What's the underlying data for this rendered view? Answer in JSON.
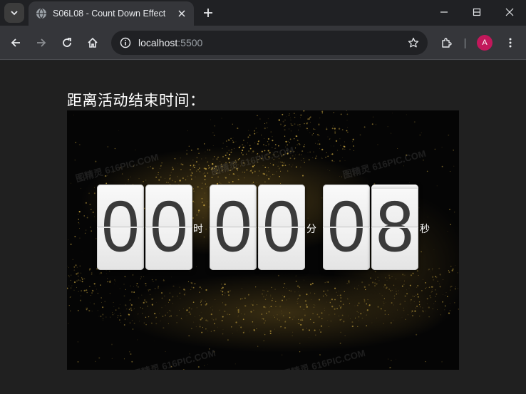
{
  "browser": {
    "tab_title": "S06L08 - Count Down Effect",
    "url_host": "localhost",
    "url_port": ":5500",
    "profile_initial": "A"
  },
  "page": {
    "heading": "距离活动结束时间：",
    "countdown": {
      "hours": [
        "0",
        "0"
      ],
      "minutes": [
        "0",
        "0"
      ],
      "seconds": [
        "0",
        "8"
      ],
      "unit_hours": "时",
      "unit_minutes": "分",
      "unit_seconds": "秒"
    },
    "watermark": "图精灵 616PIC.COM"
  },
  "colors": {
    "accent_avatar": "#c2185b",
    "card_face": "#f0f0f0",
    "digit": "#3a3a3a",
    "gold_dust": "#c9a640"
  }
}
